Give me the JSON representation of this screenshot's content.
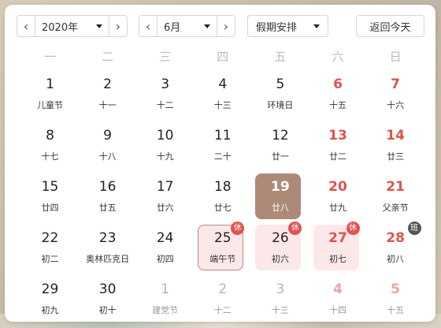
{
  "toolbar": {
    "year_value": "2020年",
    "month_value": "6月",
    "holiday_value": "假期安排",
    "today_label": "返回今天",
    "prev_glyph": "‹",
    "next_glyph": "›"
  },
  "weekdays": [
    "一",
    "二",
    "三",
    "四",
    "五",
    "六",
    "日"
  ],
  "badges": {
    "rest": "休",
    "work": "班"
  },
  "colors": {
    "weekend_red": "#e0524f",
    "today_bg": "#ad8a78",
    "rest_bg": "#fce8e8",
    "muted": "#b5b5b5"
  },
  "rows": [
    [
      {
        "d": "1",
        "sub": "儿童节",
        "type": "normal"
      },
      {
        "d": "2",
        "sub": "十一",
        "type": "normal"
      },
      {
        "d": "3",
        "sub": "十二",
        "type": "normal"
      },
      {
        "d": "4",
        "sub": "十三",
        "type": "normal"
      },
      {
        "d": "5",
        "sub": "环境日",
        "type": "normal"
      },
      {
        "d": "6",
        "sub": "十五",
        "type": "weekend"
      },
      {
        "d": "7",
        "sub": "十六",
        "type": "weekend"
      }
    ],
    [
      {
        "d": "8",
        "sub": "十七",
        "type": "normal"
      },
      {
        "d": "9",
        "sub": "十八",
        "type": "normal"
      },
      {
        "d": "10",
        "sub": "十九",
        "type": "normal"
      },
      {
        "d": "11",
        "sub": "二十",
        "type": "normal"
      },
      {
        "d": "12",
        "sub": "廿一",
        "type": "normal"
      },
      {
        "d": "13",
        "sub": "廿二",
        "type": "weekend"
      },
      {
        "d": "14",
        "sub": "廿三",
        "type": "weekend"
      }
    ],
    [
      {
        "d": "15",
        "sub": "廿四",
        "type": "normal"
      },
      {
        "d": "16",
        "sub": "廿五",
        "type": "normal"
      },
      {
        "d": "17",
        "sub": "廿六",
        "type": "normal"
      },
      {
        "d": "18",
        "sub": "廿七",
        "type": "normal"
      },
      {
        "d": "19",
        "sub": "廿八",
        "type": "today"
      },
      {
        "d": "20",
        "sub": "廿九",
        "type": "weekend"
      },
      {
        "d": "21",
        "sub": "父亲节",
        "type": "weekend"
      }
    ],
    [
      {
        "d": "22",
        "sub": "初二",
        "type": "normal"
      },
      {
        "d": "23",
        "sub": "奥林匹克日",
        "type": "normal"
      },
      {
        "d": "24",
        "sub": "初四",
        "type": "normal"
      },
      {
        "d": "25",
        "sub": "端午节",
        "type": "sel-rest",
        "badge": "rest"
      },
      {
        "d": "26",
        "sub": "初六",
        "type": "rest",
        "badge": "rest"
      },
      {
        "d": "27",
        "sub": "初七",
        "type": "rest-weekend",
        "badge": "rest"
      },
      {
        "d": "28",
        "sub": "初八",
        "type": "weekend",
        "badge": "work"
      }
    ],
    [
      {
        "d": "29",
        "sub": "初九",
        "type": "normal"
      },
      {
        "d": "30",
        "sub": "初十",
        "type": "normal"
      },
      {
        "d": "1",
        "sub": "建党节",
        "type": "other"
      },
      {
        "d": "2",
        "sub": "十二",
        "type": "other"
      },
      {
        "d": "3",
        "sub": "十三",
        "type": "other"
      },
      {
        "d": "4",
        "sub": "十四",
        "type": "other-weekend"
      },
      {
        "d": "5",
        "sub": "十五",
        "type": "other-weekend"
      }
    ]
  ]
}
